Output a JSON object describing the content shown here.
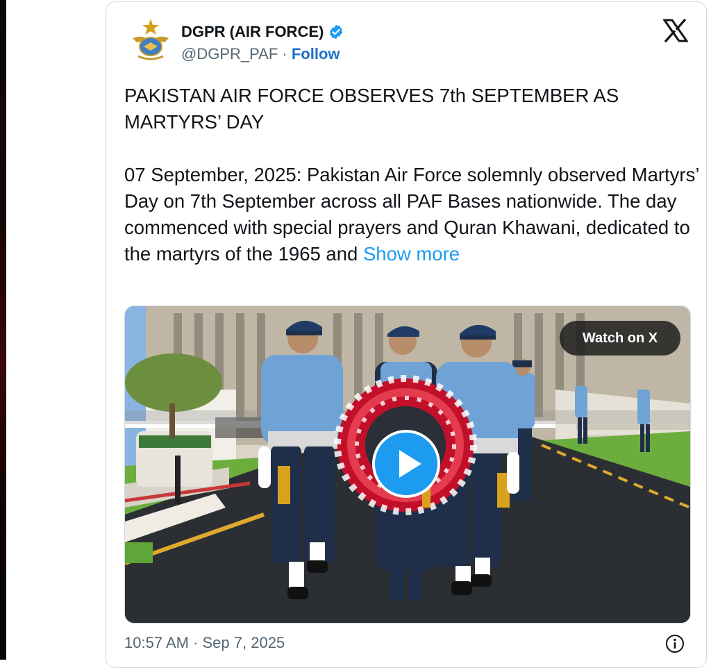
{
  "tweet": {
    "author": {
      "name": "DGPR (AIR FORCE)",
      "handle": "@DGPR_PAF",
      "separator": " · ",
      "follow_label": "Follow",
      "verified": true,
      "avatar_icon": "paf-eagle-emblem"
    },
    "platform_icon": "x-logo-icon",
    "body": {
      "headline": "PAKISTAN AIR FORCE OBSERVES 7th SEPTEMBER AS MARTYRS’ DAY",
      "paragraph": "07 September, 2025: Pakistan Air Force solemnly observed Martyrs’ Day on 7th September across all PAF Bases nationwide. The day commenced with special prayers and Quran Khawani, dedicated to the martyrs of the 1965 and ",
      "show_more_label": "Show more"
    },
    "media": {
      "type": "video",
      "watch_label": "Watch on X",
      "play_icon": "play-icon"
    },
    "timestamp": "10:57 AM · Sep 7, 2025",
    "info_icon": "info-icon"
  },
  "colors": {
    "link": "#1d9bf0",
    "follow": "#1d70c7",
    "verified": "#1d9bf0",
    "uniform": "#6fa3d6"
  }
}
